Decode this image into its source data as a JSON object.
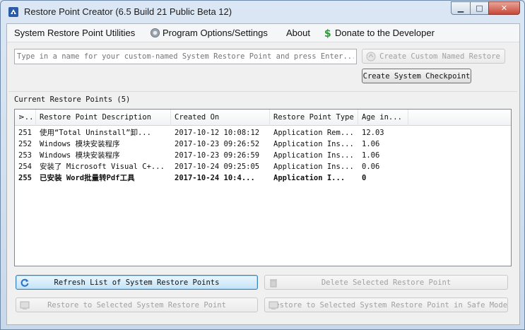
{
  "window": {
    "title": "Restore Point Creator (6.5 Build 21 Public Beta 12)",
    "controls": {
      "minimize": "▁",
      "maximize": "□",
      "close": "✕"
    }
  },
  "menu": {
    "utilities": "System Restore Point Utilities",
    "options": "Program Options/Settings",
    "about": "About",
    "donate": "Donate to the Developer"
  },
  "name_input": {
    "value": "",
    "placeholder": "Type in a name for your custom-named System Restore Point and press Enter..."
  },
  "buttons": {
    "create_named": "Create Custom Named Restore",
    "create_checkpoint": "Create System Checkpoint",
    "refresh": "Refresh List of System Restore Points",
    "delete": "Delete Selected Restore Point",
    "restore": "Restore to Selected System Restore Point",
    "restore_safe": "Restore to Selected System Restore Point in Safe Mode"
  },
  "restore_points": {
    "label": "Current Restore Points (5)",
    "columns": [
      "⋗..",
      "Restore Point Description",
      "Created On",
      "Restore Point Type",
      "Age in..."
    ],
    "rows": [
      {
        "id": "251",
        "description": "使用“Total Uninstall”卸...",
        "created": "2017-10-12 10:08:12",
        "type": "Application Rem...",
        "age": "12.03",
        "bold": false
      },
      {
        "id": "252",
        "description": "Windows 模块安装程序",
        "created": "2017-10-23 09:26:52",
        "type": "Application Ins...",
        "age": "1.06",
        "bold": false
      },
      {
        "id": "253",
        "description": "Windows 模块安装程序",
        "created": "2017-10-23 09:26:59",
        "type": "Application Ins...",
        "age": "1.06",
        "bold": false
      },
      {
        "id": "254",
        "description": "安装了 Microsoft Visual C+...",
        "created": "2017-10-24 09:25:05",
        "type": "Application Ins...",
        "age": "0.06",
        "bold": false
      },
      {
        "id": "255",
        "description": "已安装 Word批量转Pdf工具",
        "created": "2017-10-24 10:4...",
        "type": "Application I...",
        "age": "0",
        "bold": true
      }
    ]
  },
  "colors": {
    "accent_border": "#3c7fb1",
    "disabled_text": "#a0a0a0",
    "donate_icon": "#2e9b3a"
  }
}
